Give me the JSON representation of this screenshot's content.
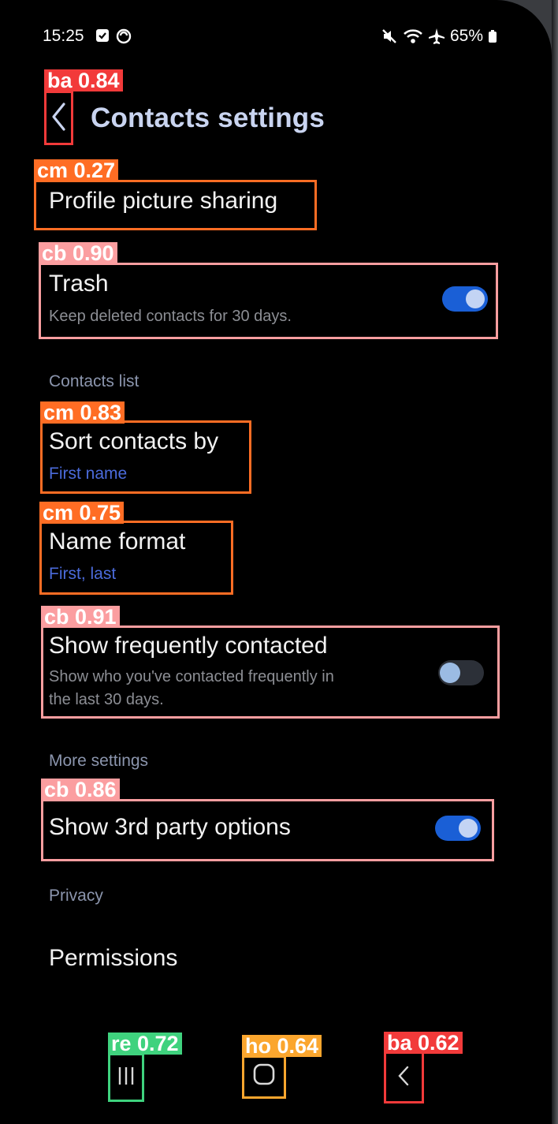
{
  "status_bar": {
    "time": "15:25",
    "battery": "65%",
    "icons": [
      "notification-check-icon",
      "sync-icon",
      "mute-icon",
      "wifi-icon",
      "airplane-icon",
      "battery-icon"
    ]
  },
  "header": {
    "back_icon": "chevron-left-icon",
    "title": "Contacts settings"
  },
  "settings": {
    "profile_picture": {
      "title": "Profile picture sharing"
    },
    "trash": {
      "title": "Trash",
      "subtitle": "Keep deleted contacts for 30 days.",
      "enabled": true
    },
    "contacts_list_header": "Contacts list",
    "sort_by": {
      "title": "Sort contacts by",
      "value": "First name"
    },
    "name_format": {
      "title": "Name format",
      "value": "First, last"
    },
    "frequently_contacted": {
      "title": "Show frequently contacted",
      "subtitle_line1": "Show who you've contacted frequently in",
      "subtitle_line2": "the last 30 days.",
      "enabled": false
    },
    "more_settings_header": "More settings",
    "third_party": {
      "title": "Show 3rd party options",
      "enabled": true
    },
    "privacy_header": "Privacy",
    "permissions": {
      "title": "Permissions"
    }
  },
  "nav_bar": {
    "recents_icon": "recents-icon",
    "home_icon": "home-icon",
    "back_icon": "chevron-left-icon"
  },
  "detections": [
    {
      "label": "ba 0.84",
      "color": "#f23a3a"
    },
    {
      "label": "cm 0.27",
      "color": "#ff6d24"
    },
    {
      "label": "cb 0.90",
      "color": "#fb9ea0"
    },
    {
      "label": "cm 0.83",
      "color": "#ff6d24"
    },
    {
      "label": "cm 0.75",
      "color": "#ff6d24"
    },
    {
      "label": "cb 0.91",
      "color": "#fb9ea0"
    },
    {
      "label": "cb 0.86",
      "color": "#fb9ea0"
    },
    {
      "label": "re 0.72",
      "color": "#3fd27e"
    },
    {
      "label": "ho 0.64",
      "color": "#fba62e"
    },
    {
      "label": "ba 0.62",
      "color": "#f23a3a"
    }
  ],
  "colors": {
    "background": "#000000",
    "title": "#c9d4f0",
    "accent_value": "#4b6bdb",
    "toggle_on": "#1a5fd6",
    "toggle_off": "#2c3038"
  }
}
